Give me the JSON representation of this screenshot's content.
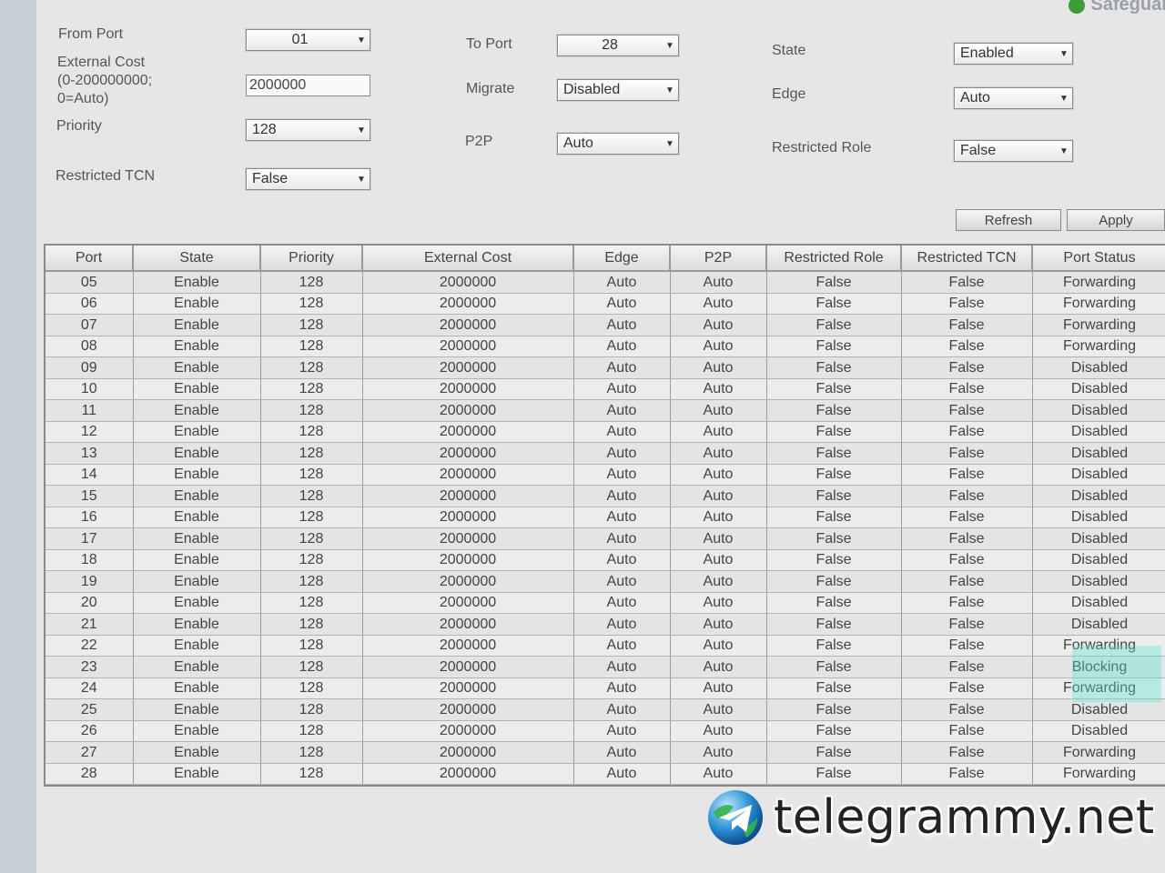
{
  "brand": {
    "text": "Safeguar"
  },
  "form": {
    "from_port": {
      "label": "From Port",
      "value": "01"
    },
    "external_cost": {
      "label_line1": "External Cost",
      "label_line2": "(0-200000000;",
      "label_line3": "0=Auto)",
      "value": "2000000"
    },
    "priority": {
      "label": "Priority",
      "value": "128"
    },
    "restricted_tcn": {
      "label": "Restricted TCN",
      "value": "False"
    },
    "to_port": {
      "label": "To Port",
      "value": "28"
    },
    "migrate": {
      "label": "Migrate",
      "value": "Disabled"
    },
    "p2p": {
      "label": "P2P",
      "value": "Auto"
    },
    "state": {
      "label": "State",
      "value": "Enabled"
    },
    "edge": {
      "label": "Edge",
      "value": "Auto"
    },
    "restricted_role": {
      "label": "Restricted Role",
      "value": "False"
    }
  },
  "buttons": {
    "refresh": "Refresh",
    "apply": "Apply"
  },
  "table": {
    "headers": [
      "Port",
      "State",
      "Priority",
      "External Cost",
      "Edge",
      "P2P",
      "Restricted Role",
      "Restricted TCN",
      "Port Status"
    ],
    "rows": [
      [
        "05",
        "Enable",
        "128",
        "2000000",
        "Auto",
        "Auto",
        "False",
        "False",
        "Forwarding"
      ],
      [
        "06",
        "Enable",
        "128",
        "2000000",
        "Auto",
        "Auto",
        "False",
        "False",
        "Forwarding"
      ],
      [
        "07",
        "Enable",
        "128",
        "2000000",
        "Auto",
        "Auto",
        "False",
        "False",
        "Forwarding"
      ],
      [
        "08",
        "Enable",
        "128",
        "2000000",
        "Auto",
        "Auto",
        "False",
        "False",
        "Forwarding"
      ],
      [
        "09",
        "Enable",
        "128",
        "2000000",
        "Auto",
        "Auto",
        "False",
        "False",
        "Disabled"
      ],
      [
        "10",
        "Enable",
        "128",
        "2000000",
        "Auto",
        "Auto",
        "False",
        "False",
        "Disabled"
      ],
      [
        "11",
        "Enable",
        "128",
        "2000000",
        "Auto",
        "Auto",
        "False",
        "False",
        "Disabled"
      ],
      [
        "12",
        "Enable",
        "128",
        "2000000",
        "Auto",
        "Auto",
        "False",
        "False",
        "Disabled"
      ],
      [
        "13",
        "Enable",
        "128",
        "2000000",
        "Auto",
        "Auto",
        "False",
        "False",
        "Disabled"
      ],
      [
        "14",
        "Enable",
        "128",
        "2000000",
        "Auto",
        "Auto",
        "False",
        "False",
        "Disabled"
      ],
      [
        "15",
        "Enable",
        "128",
        "2000000",
        "Auto",
        "Auto",
        "False",
        "False",
        "Disabled"
      ],
      [
        "16",
        "Enable",
        "128",
        "2000000",
        "Auto",
        "Auto",
        "False",
        "False",
        "Disabled"
      ],
      [
        "17",
        "Enable",
        "128",
        "2000000",
        "Auto",
        "Auto",
        "False",
        "False",
        "Disabled"
      ],
      [
        "18",
        "Enable",
        "128",
        "2000000",
        "Auto",
        "Auto",
        "False",
        "False",
        "Disabled"
      ],
      [
        "19",
        "Enable",
        "128",
        "2000000",
        "Auto",
        "Auto",
        "False",
        "False",
        "Disabled"
      ],
      [
        "20",
        "Enable",
        "128",
        "2000000",
        "Auto",
        "Auto",
        "False",
        "False",
        "Disabled"
      ],
      [
        "21",
        "Enable",
        "128",
        "2000000",
        "Auto",
        "Auto",
        "False",
        "False",
        "Disabled"
      ],
      [
        "22",
        "Enable",
        "128",
        "2000000",
        "Auto",
        "Auto",
        "False",
        "False",
        "Forwarding"
      ],
      [
        "23",
        "Enable",
        "128",
        "2000000",
        "Auto",
        "Auto",
        "False",
        "False",
        "Blocking"
      ],
      [
        "24",
        "Enable",
        "128",
        "2000000",
        "Auto",
        "Auto",
        "False",
        "False",
        "Forwarding"
      ],
      [
        "25",
        "Enable",
        "128",
        "2000000",
        "Auto",
        "Auto",
        "False",
        "False",
        "Disabled"
      ],
      [
        "26",
        "Enable",
        "128",
        "2000000",
        "Auto",
        "Auto",
        "False",
        "False",
        "Disabled"
      ],
      [
        "27",
        "Enable",
        "128",
        "2000000",
        "Auto",
        "Auto",
        "False",
        "False",
        "Forwarding"
      ],
      [
        "28",
        "Enable",
        "128",
        "2000000",
        "Auto",
        "Auto",
        "False",
        "False",
        "Forwarding"
      ]
    ]
  },
  "watermark": {
    "text": "telegrammy.net"
  },
  "colors": {
    "page_bg": "#e6e6e6",
    "highlight": "#50e6d2",
    "brand_dot": "#3f9a3a"
  }
}
